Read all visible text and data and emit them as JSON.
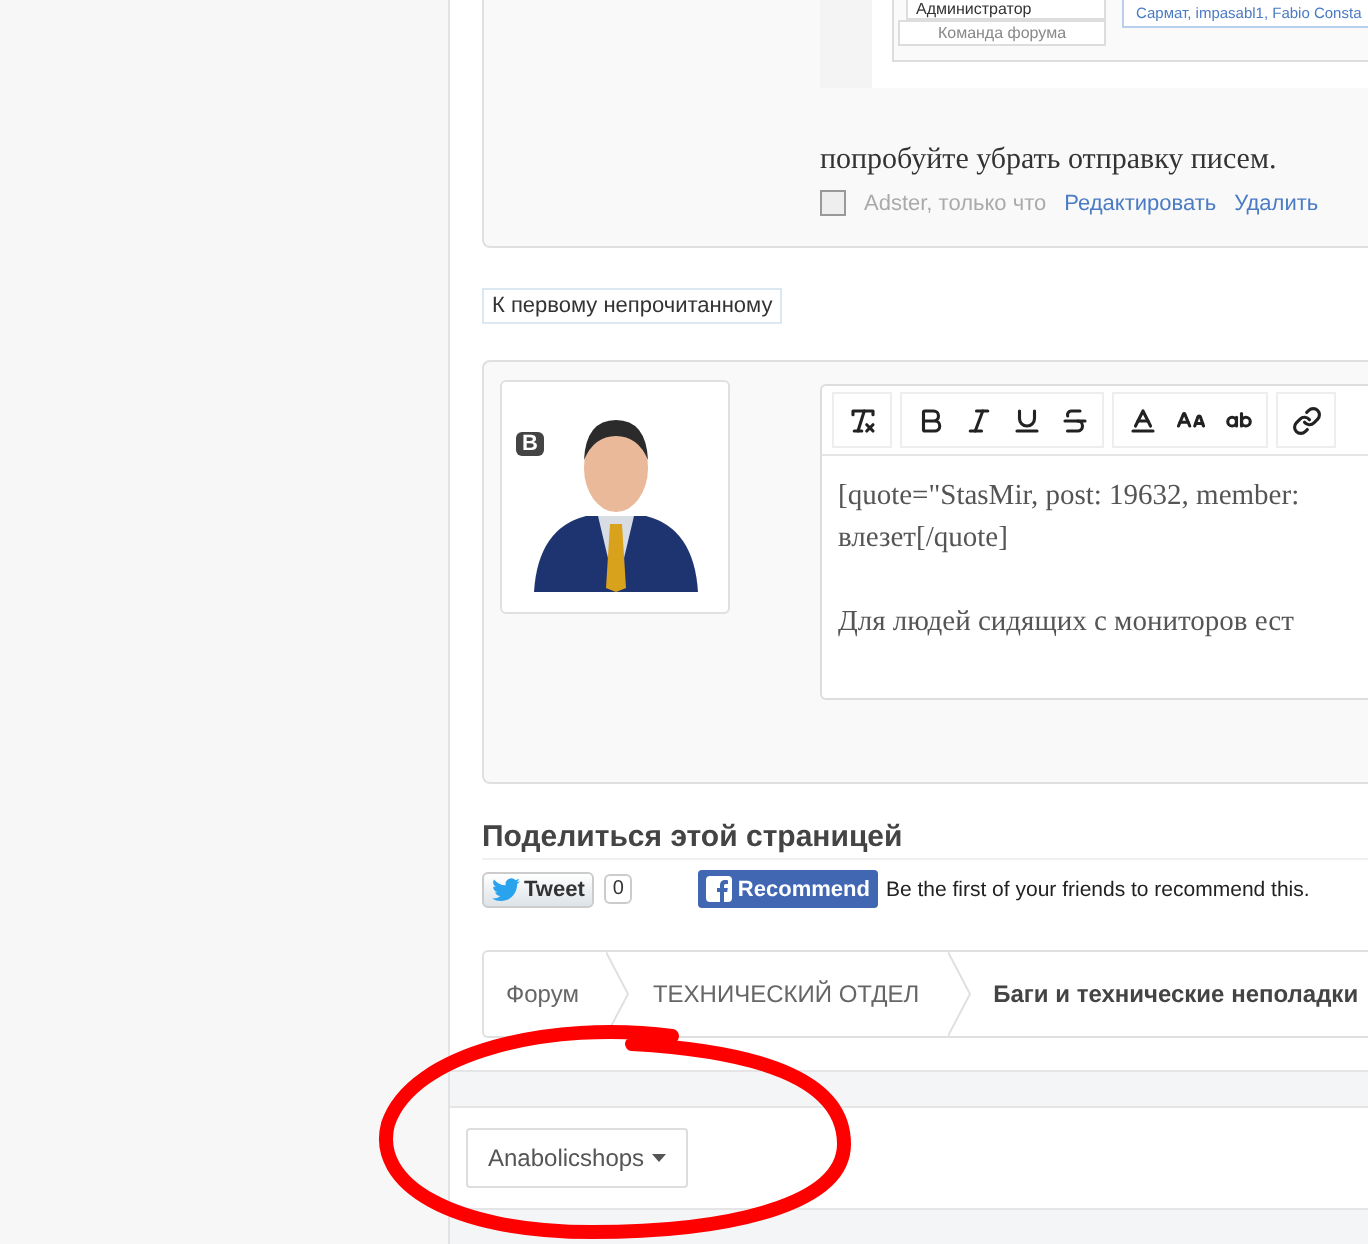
{
  "embedded_screenshot": {
    "role": "Администратор",
    "group": "Команда форума",
    "likes": "Сармат, impasabl1, Fabio Consta"
  },
  "post": {
    "text": "попробуйте убрать отправку писем.",
    "checked": false,
    "byline": "Adster, только что",
    "actions": [
      "Редактировать",
      "Удалить"
    ]
  },
  "unread_button": "К первому непрочитанному",
  "reply": {
    "badge": "B",
    "paragraphs": [
      [
        "[quote=\"StasMir, post: 19632, member:",
        "влезет[/quote]"
      ],
      [
        "Для людей сидящих с мониторов ест"
      ]
    ]
  },
  "share": {
    "title": "Поделиться этой страницей",
    "tweet": "Tweet",
    "tweet_count": "0",
    "recommend": "Recommend",
    "recommend_note": "Be the first of your friends to recommend this."
  },
  "breadcrumbs": [
    {
      "label": "Форум",
      "current": false
    },
    {
      "label": "ТЕХНИЧЕСКИЙ ОТДЕЛ",
      "current": false
    },
    {
      "label": "Баги и технические неполадки",
      "current": true
    }
  ],
  "footer": {
    "style_chooser": "Anabolicshops"
  }
}
